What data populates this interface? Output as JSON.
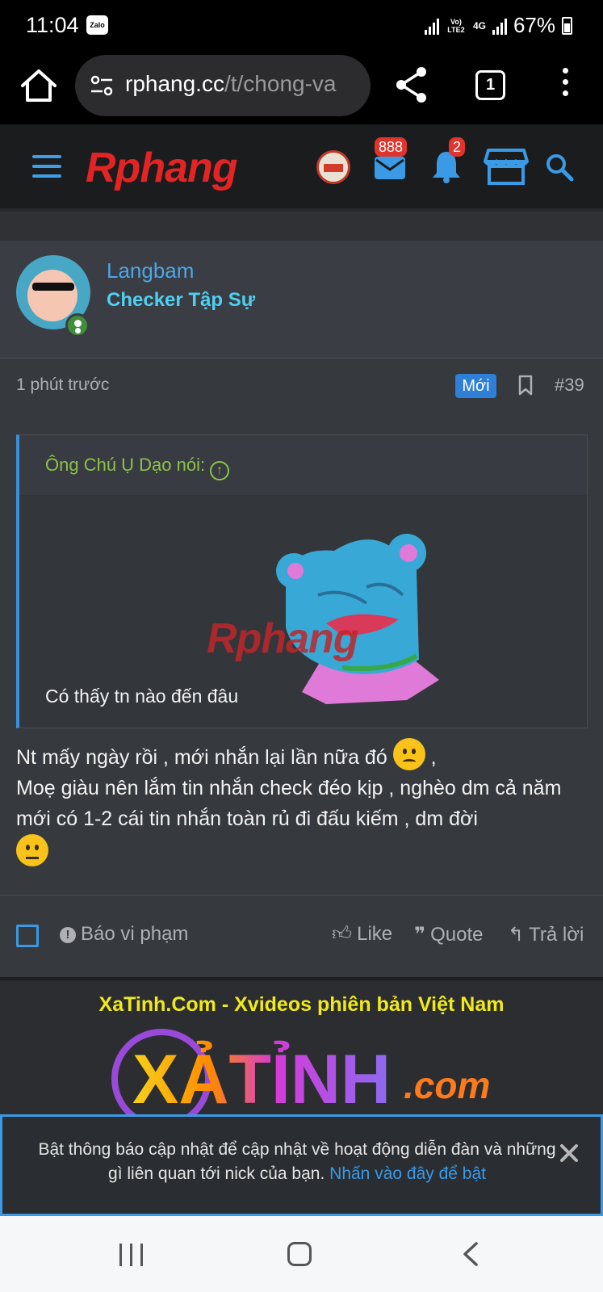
{
  "status_bar": {
    "time": "11:04",
    "zalo_label": "Zalo",
    "volte_label": "Vo) LTE2",
    "net_label": "4G",
    "battery": "67%"
  },
  "browser": {
    "url_host": "rphang.cc",
    "url_path": "/t/chong-va",
    "tab_count": "1"
  },
  "site_header": {
    "logo_text": "Rphang",
    "messages_count": "888",
    "alerts_count": "2"
  },
  "post": {
    "username": "Langbam",
    "user_title": "Checker Tập Sự",
    "time": "1 phút trước",
    "new_badge": "Mới",
    "post_number": "#39",
    "quote": {
      "author": "Ông Chú Ụ Dạo nói:",
      "watermark": "Rphang",
      "text": "Có thấy tn nào đến đâu"
    },
    "body": {
      "line1": "Nt mấy ngày rồi , mới nhắn lại lần nữa đó",
      "line1_end": ",",
      "line2": "Moẹ giàu nên lắm tin nhắn check đéo kịp , nghèo dm cả năm mới có 1-2 cái tin nhắn toàn rủ đi đấu kiếm , dm đời"
    },
    "actions": {
      "report": "Báo vi phạm",
      "like": "Like",
      "quote": "Quote",
      "reply": "Trả lời"
    }
  },
  "ad": {
    "title": "XaTinh.Com - Xvideos phiên bản Việt Nam",
    "logo_text": "XẢTỈNH",
    "logo_suffix": ".com"
  },
  "notification": {
    "text": "Bật thông báo cập nhật để cập nhật về hoạt động diễn đàn và những gì liên quan tới nick của bạn.",
    "link": "Nhấn vào đây để bật"
  },
  "colors": {
    "accent_blue": "#3a9ae6",
    "username_blue": "#4ea6e6",
    "user_title_cyan": "#4fd0f2",
    "quote_green": "#8dc24a",
    "badge_red": "#e0342d",
    "ad_yellow": "#f1ea18"
  },
  "icons": [
    "home-icon",
    "site-settings-icon",
    "share-icon",
    "tabs-icon",
    "more-icon",
    "hamburger-icon",
    "mail-icon",
    "bell-icon",
    "store-icon",
    "search-icon",
    "bookmark-icon",
    "warning-icon",
    "like-icon",
    "quote-icon",
    "reply-icon",
    "close-icon"
  ]
}
